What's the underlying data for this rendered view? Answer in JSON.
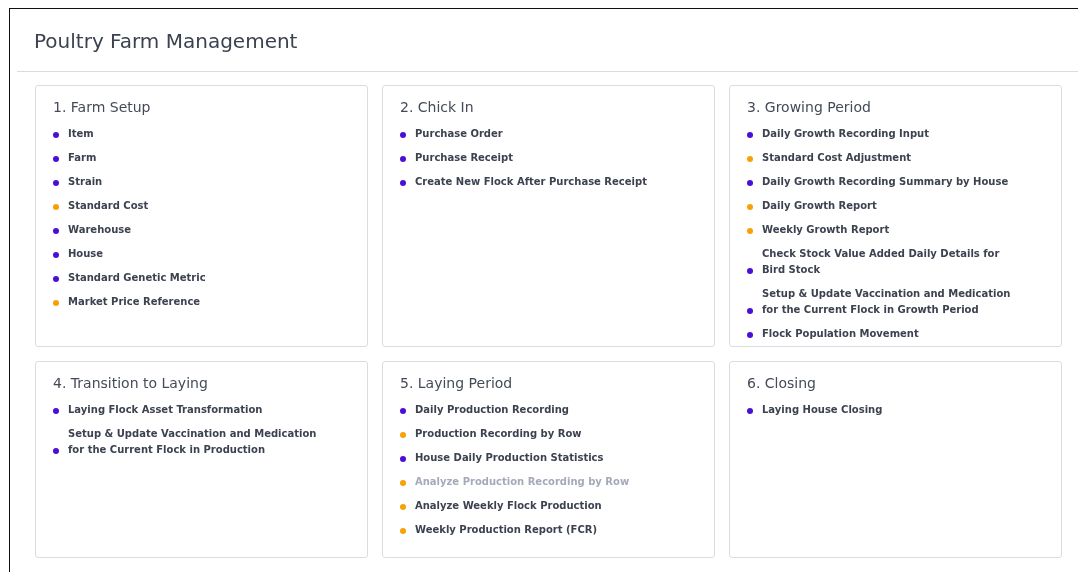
{
  "page": {
    "title": "Poultry Farm Management"
  },
  "sections": [
    {
      "title": "1. Farm Setup",
      "items": [
        {
          "label": "Item",
          "color": "#4a0fd6",
          "disabled": false
        },
        {
          "label": "Farm",
          "color": "#4a0fd6",
          "disabled": false
        },
        {
          "label": "Strain",
          "color": "#4a0fd6",
          "disabled": false
        },
        {
          "label": "Standard Cost",
          "color": "#f7a10a",
          "disabled": false
        },
        {
          "label": "Warehouse",
          "color": "#4a0fd6",
          "disabled": false
        },
        {
          "label": "House",
          "color": "#4a0fd6",
          "disabled": false
        },
        {
          "label": "Standard Genetic Metric",
          "color": "#4a0fd6",
          "disabled": false
        },
        {
          "label": "Market Price Reference",
          "color": "#f7a10a",
          "disabled": false
        }
      ]
    },
    {
      "title": "2. Chick In",
      "items": [
        {
          "label": "Purchase Order",
          "color": "#4a0fd6",
          "disabled": false
        },
        {
          "label": "Purchase Receipt",
          "color": "#4a0fd6",
          "disabled": false
        },
        {
          "label": "Create New Flock After Purchase Receipt",
          "color": "#4a0fd6",
          "disabled": false
        }
      ]
    },
    {
      "title": "3. Growing Period",
      "items": [
        {
          "label": "Daily Growth Recording Input",
          "color": "#4a0fd6",
          "disabled": false
        },
        {
          "label": "Standard Cost Adjustment",
          "color": "#f7a10a",
          "disabled": false
        },
        {
          "label": "Daily Growth Recording Summary by House",
          "color": "#4a0fd6",
          "disabled": false
        },
        {
          "label": "Daily Growth Report",
          "color": "#f7a10a",
          "disabled": false
        },
        {
          "label": "Weekly Growth Report",
          "color": "#f7a10a",
          "disabled": false
        },
        {
          "label": "Check Stock Value Added Daily Details for Bird Stock",
          "color": "#4a0fd6",
          "disabled": false
        },
        {
          "label": "Setup & Update Vaccination and Medication for the Current Flock in Growth Period",
          "color": "#4a0fd6",
          "disabled": false
        },
        {
          "label": "Flock Population Movement",
          "color": "#4a0fd6",
          "disabled": false
        }
      ]
    },
    {
      "title": "4. Transition to Laying",
      "items": [
        {
          "label": "Laying Flock Asset Transformation",
          "color": "#4a0fd6",
          "disabled": false
        },
        {
          "label": "Setup & Update Vaccination and Medication for the Current Flock in Production",
          "color": "#4a0fd6",
          "disabled": false
        }
      ]
    },
    {
      "title": "5. Laying Period",
      "items": [
        {
          "label": "Daily Production Recording",
          "color": "#4a0fd6",
          "disabled": false
        },
        {
          "label": "Production Recording by Row",
          "color": "#f7a10a",
          "disabled": false
        },
        {
          "label": "House Daily Production Statistics",
          "color": "#4a0fd6",
          "disabled": false
        },
        {
          "label": "Analyze Production Recording by Row",
          "color": "#f7a10a",
          "disabled": true
        },
        {
          "label": "Analyze Weekly Flock Production",
          "color": "#f7a10a",
          "disabled": false
        },
        {
          "label": "Weekly Production Report (FCR)",
          "color": "#f7a10a",
          "disabled": false
        }
      ]
    },
    {
      "title": "6. Closing",
      "items": [
        {
          "label": "Laying House Closing",
          "color": "#4a0fd6",
          "disabled": false
        }
      ]
    }
  ]
}
